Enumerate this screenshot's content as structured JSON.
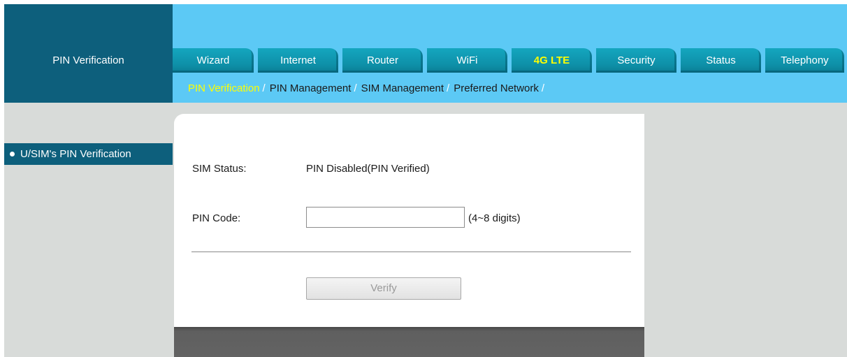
{
  "header": {
    "section_title": "PIN Verification",
    "tabs": [
      {
        "label": "Wizard",
        "active": false
      },
      {
        "label": "Internet",
        "active": false
      },
      {
        "label": "Router",
        "active": false
      },
      {
        "label": "WiFi",
        "active": false
      },
      {
        "label": "4G LTE",
        "active": true
      },
      {
        "label": "Security",
        "active": false
      },
      {
        "label": "Status",
        "active": false
      },
      {
        "label": "Telephony",
        "active": false
      }
    ],
    "subnav": [
      {
        "label": "PIN Verification",
        "active": true
      },
      {
        "label": "PIN Management",
        "active": false
      },
      {
        "label": "SIM Management",
        "active": false
      },
      {
        "label": "Preferred Network",
        "active": false
      }
    ],
    "subnav_separator": "/"
  },
  "sidebar": {
    "items": [
      {
        "label": "U/SIM's PIN Verification",
        "active": true
      }
    ]
  },
  "form": {
    "sim_status_label": "SIM Status:",
    "sim_status_value": "PIN Disabled(PIN Verified)",
    "pin_code_label": "PIN Code:",
    "pin_code_value": "",
    "pin_code_hint": "(4~8 digits)",
    "verify_label": "Verify",
    "verify_enabled": false
  },
  "colors": {
    "header_dark": "#0d5f7c",
    "header_light": "#5cc9f5",
    "tab": "#0e8fa7",
    "active_highlight": "#ffff00",
    "panel_gray": "#d8dbd9"
  }
}
